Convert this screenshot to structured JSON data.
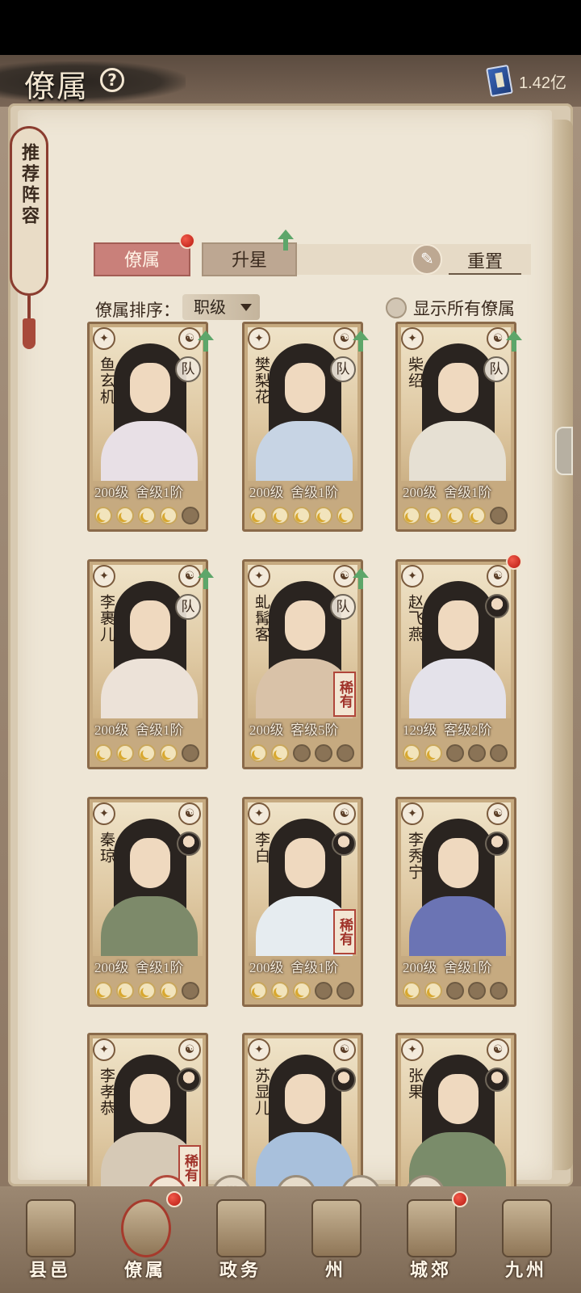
{
  "header": {
    "title": "僚属",
    "currency_value": "1.42亿",
    "currency_icon": "book-icon"
  },
  "recommend_tag": "推荐阵容",
  "tabs": [
    {
      "label": "僚属",
      "active": true
    },
    {
      "label": "升星",
      "active": false
    }
  ],
  "reset_label": "重置",
  "sort": {
    "label": "僚属排序：",
    "value": "职级"
  },
  "show_all_label": "显示所有僚属",
  "team_badge": "队",
  "rare_badge": "稀有",
  "cards": [
    {
      "name": "鱼玄机",
      "level": "200级",
      "rank": "舍级1阶",
      "stars": 4,
      "team": true,
      "upgrade": true,
      "rare": false,
      "dot": false
    },
    {
      "name": "樊梨花",
      "level": "200级",
      "rank": "舍级1阶",
      "stars": 5,
      "team": true,
      "upgrade": true,
      "rare": false,
      "dot": false
    },
    {
      "name": "柴绍",
      "level": "200级",
      "rank": "舍级1阶",
      "stars": 4,
      "team": true,
      "upgrade": true,
      "rare": false,
      "dot": false
    },
    {
      "name": "李裹儿",
      "level": "200级",
      "rank": "舍级1阶",
      "stars": 4,
      "team": true,
      "upgrade": true,
      "rare": false,
      "dot": false
    },
    {
      "name": "虬髯客",
      "level": "200级",
      "rank": "客级5阶",
      "stars": 2,
      "team": true,
      "upgrade": true,
      "rare": true,
      "dot": false
    },
    {
      "name": "赵飞燕",
      "level": "129级",
      "rank": "客级2阶",
      "stars": 2,
      "team": false,
      "upgrade": false,
      "rare": false,
      "dot": true
    },
    {
      "name": "秦琼",
      "level": "200级",
      "rank": "舍级1阶",
      "stars": 4,
      "team": false,
      "upgrade": false,
      "rare": false,
      "dot": false
    },
    {
      "name": "李白",
      "level": "200级",
      "rank": "舍级1阶",
      "stars": 3,
      "team": false,
      "upgrade": false,
      "rare": true,
      "dot": false
    },
    {
      "name": "李秀宁",
      "level": "200级",
      "rank": "舍级1阶",
      "stars": 2,
      "team": false,
      "upgrade": false,
      "rare": false,
      "dot": false
    },
    {
      "name": "李孝恭",
      "level": "",
      "rank": "",
      "stars": 0,
      "team": false,
      "upgrade": false,
      "rare": true,
      "dot": false
    },
    {
      "name": "苏显儿",
      "level": "",
      "rank": "",
      "stars": 0,
      "team": false,
      "upgrade": false,
      "rare": false,
      "dot": false
    },
    {
      "name": "张果",
      "level": "",
      "rank": "",
      "stars": 0,
      "team": false,
      "upgrade": false,
      "rare": false,
      "dot": false
    }
  ],
  "filters": [
    {
      "icon": "all-icon",
      "glyph": "❖",
      "active": true
    },
    {
      "icon": "bell-icon",
      "glyph": "♜",
      "active": false
    },
    {
      "icon": "gourd-icon",
      "glyph": "♞",
      "active": false
    },
    {
      "icon": "fan-icon",
      "glyph": "◔",
      "active": false
    },
    {
      "icon": "beast-icon",
      "glyph": "♝",
      "active": false
    }
  ],
  "nav": [
    {
      "label": "县邑",
      "dot": false
    },
    {
      "label": "僚属",
      "dot": true,
      "active": true
    },
    {
      "label": "政务",
      "dot": false
    },
    {
      "label": "州",
      "dot": false
    },
    {
      "label": "城郊",
      "dot": true
    },
    {
      "label": "九州",
      "dot": false
    }
  ],
  "colors": {
    "accent_red": "#b24a3c",
    "page": "#eee6d6",
    "tab_active": "#c9807a",
    "upgrade_green": "#5da66a"
  }
}
